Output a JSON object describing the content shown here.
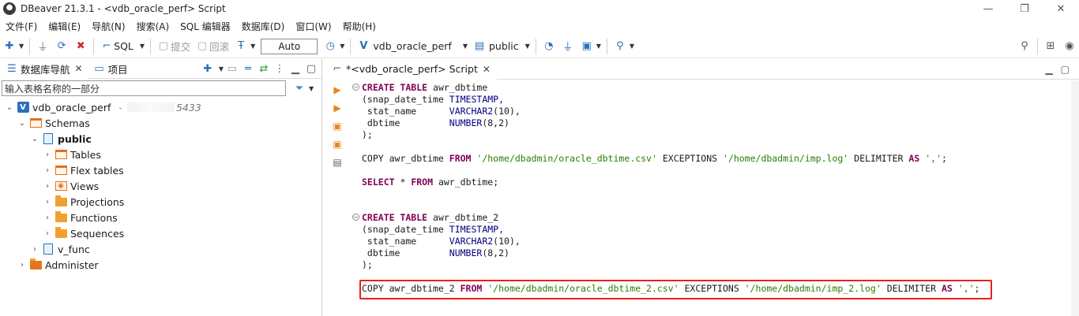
{
  "window": {
    "title": "DBeaver 21.3.1 - <vdb_oracle_perf> Script",
    "minimize": "—",
    "restore": "❐",
    "close": "✕"
  },
  "menu": [
    "文件(F)",
    "编辑(E)",
    "导航(N)",
    "搜索(A)",
    "SQL 编辑器",
    "数据库(D)",
    "窗口(W)",
    "帮助(H)"
  ],
  "toolbar": {
    "sql_label": "SQL",
    "commit_label": "提交",
    "rollback_label": "回滚",
    "auto_label": "Auto",
    "connection_label": "vdb_oracle_perf",
    "schema_label": "public"
  },
  "left_panel": {
    "tab_navigator": "数据库导航",
    "tab_projects": "项目",
    "filter_placeholder": "输入表格名称的一部分",
    "tree": {
      "connection": "vdb_oracle_perf",
      "connection_suffix": "5433",
      "schemas": "Schemas",
      "public": "public",
      "tables": "Tables",
      "flex_tables": "Flex tables",
      "views": "Views",
      "projections": "Projections",
      "functions": "Functions",
      "sequences": "Sequences",
      "v_func": "v_func",
      "administer": "Administer"
    }
  },
  "editor": {
    "tab_title": "*<vdb_oracle_perf> Script",
    "code": {
      "l1_kw": "CREATE TABLE",
      "l1_rest": " awr_dbtime",
      "l2_a": "(snap_date_time ",
      "l2_ty": "TIMESTAMP",
      "l2_b": ",",
      "l3_a": " stat_name      ",
      "l3_ty": "VARCHAR2",
      "l3_b": "(10),",
      "l4_a": " dbtime         ",
      "l4_ty": "NUMBER",
      "l4_b": "(8,2)",
      "l5": ");",
      "l6_a": "COPY awr_dbtime ",
      "l6_kw1": "FROM",
      "l6_s1": " '/home/dbadmin/oracle_dbtime.csv'",
      "l6_b": " EXCEPTIONS ",
      "l6_s2": "'/home/dbadmin/imp.log'",
      "l6_c": " DELIMITER ",
      "l6_kw2": "AS",
      "l6_s3": " ','",
      "l6_d": ";",
      "l7_kw": "SELECT",
      "l7_a": " * ",
      "l7_kw2": "FROM",
      "l7_b": " awr_dbtime;",
      "l8_kw": "CREATE TABLE",
      "l8_rest": " awr_dbtime_2",
      "l9_a": "(snap_date_time ",
      "l9_ty": "TIMESTAMP",
      "l9_b": ",",
      "l10_a": " stat_name      ",
      "l10_ty": "VARCHAR2",
      "l10_b": "(10),",
      "l11_a": " dbtime         ",
      "l11_ty": "NUMBER",
      "l11_b": "(8,2)",
      "l12": ");",
      "l13_a": "COPY awr_dbtime_2 ",
      "l13_kw1": "FROM",
      "l13_s1": " '/home/dbadmin/oracle_dbtime_2.csv'",
      "l13_b": " EXCEPTIONS ",
      "l13_s2": "'/home/dbadmin/imp_2.log'",
      "l13_c": " DELIMITER ",
      "l13_kw2": "AS",
      "l13_s3": " ','",
      "l13_d": ";"
    }
  },
  "colors": {
    "highlight_box": "#e8201a",
    "keyword": "#7f0055",
    "string": "#2a7f00",
    "type": "#00007f"
  }
}
